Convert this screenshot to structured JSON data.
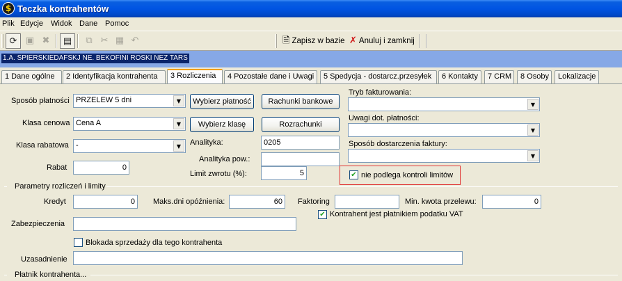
{
  "window": {
    "title": "Teczka kontrahentów",
    "app_icon": "$"
  },
  "menu": [
    "Plik",
    "Edycje",
    "Widok",
    "Dane",
    "Pomoc"
  ],
  "toolbar": {
    "save_label": "Zapisz w bazie",
    "cancel_label": "Anuluj i zamknij"
  },
  "contractor": {
    "name": "1.A. SPIERSKIEDAFSKJ NE. BEKOFINI ROSKI NEZ TARS"
  },
  "tabs": [
    "1 Dane ogólne",
    "2 Identyfikacja kontrahenta",
    "3 Rozliczenia",
    "4 Pozostałe dane i Uwagi",
    "5 Spedycja - dostarcz.przesyłek",
    "6 Kontakty",
    "7 CRM",
    "8 Osoby",
    "Lokalizacje"
  ],
  "active_tab": "3 Rozliczenia",
  "form": {
    "payment_method_label": "Sposób płatności",
    "payment_method_value": "PRZELEW 5 dni",
    "choose_payment_button": "Wybierz płatność",
    "bank_accounts_button": "Rachunki bankowe",
    "price_class_label": "Klasa cenowa",
    "price_class_value": "Cena A",
    "choose_class_button": "Wybierz klasę",
    "settlements_button": "Rozrachunki",
    "discount_class_label": "Klasa rabatowa",
    "discount_class_value": "-",
    "discount_label": "Rabat",
    "discount_value": "0",
    "analytics_label": "Analityka:",
    "analytics_value": "0205",
    "analytics_rel_label": "Analityka pow.:",
    "analytics_rel_value": "",
    "return_limit_label": "Limit zwrotu (%):",
    "return_limit_value": "5",
    "invoicing_mode_label": "Tryb fakturowania:",
    "invoicing_mode_value": "",
    "payment_notes_label": "Uwagi dot. płatności:",
    "payment_notes_value": "",
    "invoice_delivery_label": "Sposób dostarczenia faktury:",
    "invoice_delivery_value": "",
    "no_limit_control_label": "nie podlega kontroli limitów",
    "no_limit_control_checked": true
  },
  "limits": {
    "group_label": "Parametry rozliczeń i limity",
    "credit_label": "Kredyt",
    "credit_value": "0",
    "max_delay_label": "Maks.dni opóźnienia:",
    "max_delay_value": "60",
    "factoring_label": "Faktoring",
    "factoring_value": "",
    "min_transfer_label": "Min. kwota przelewu:",
    "min_transfer_value": "0",
    "vat_payer_label": "Kontrahent jest płatnikiem podatku VAT",
    "vat_payer_checked": true,
    "collateral_label": "Zabezpieczenia",
    "collateral_value": "",
    "sales_block_label": "Blokada sprzedaży dla tego kontrahenta",
    "sales_block_checked": false,
    "justification_label": "Uzasadnienie",
    "justification_value": ""
  },
  "payer": {
    "group_label": "Płatnik kontrahenta..."
  },
  "colors": {
    "title_bar": "#0054e3",
    "contractor_bar": "#86a8e6",
    "highlight": "#e03030"
  }
}
